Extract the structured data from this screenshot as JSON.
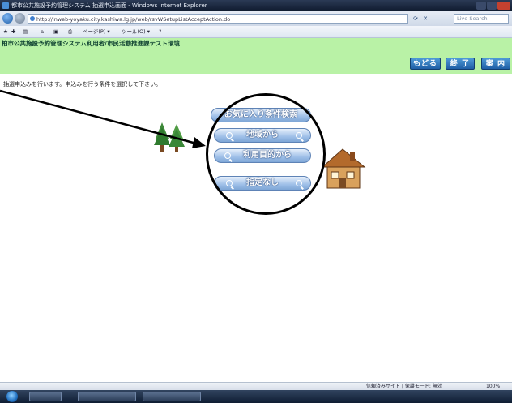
{
  "window": {
    "title": "都市公共施設予約管理システム 抽選申込画面 - Windows Internet Explorer"
  },
  "address_bar": {
    "url": "http://inweb-yoyaku.city.kashiwa.lg.jp/web/rsvWSetupListAcceptAction.do",
    "search_placeholder": "Live Search"
  },
  "command_bar": {
    "items": [
      "ページ(P) ▾",
      "ツール(O) ▾"
    ]
  },
  "page": {
    "system_title": "柏市公共施設予約管理システム利用者/市民活動推進課テスト環境",
    "header_buttons": [
      "もどる",
      "終 了",
      "案 内"
    ],
    "instruction": "抽選申込みを行います。申込みを行う条件を選択して下さい。",
    "menu": {
      "favorites_search": "お気に入り条件検索",
      "by_area": "地域から",
      "by_purpose": "利用目的から",
      "no_specification": "指定なし"
    }
  },
  "status_bar": {
    "zone": "信頼済みサイト | 保護モード: 無効",
    "zoom": "100%"
  },
  "colors": {
    "header_band": "#b9f2a6",
    "header_button": "#1f5fa6",
    "menu_button": "#9fc0e8"
  }
}
